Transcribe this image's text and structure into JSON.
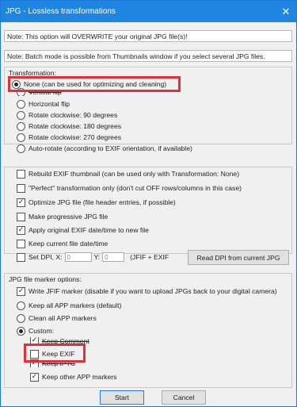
{
  "window": {
    "title": "JPG - Lossless transformations",
    "close_glyph": "✕"
  },
  "notes": {
    "overwrite": "Note: This option will OVERWRITE your original JPG file(s)!",
    "batch": "Note: Batch mode is possible from Thumbnails window if you select several JPG files."
  },
  "transformation": {
    "label": "Transformation:",
    "options": [
      {
        "label": "None (can be used for optimizing and cleaning)",
        "selected": true
      },
      {
        "label": "Vertical flip",
        "selected": false
      },
      {
        "label": "Horizontal flip",
        "selected": false
      },
      {
        "label": "Rotate clockwise: 90 degrees",
        "selected": false
      },
      {
        "label": "Rotate clockwise: 180 degrees",
        "selected": false
      },
      {
        "label": "Rotate clockwise: 270 degrees",
        "selected": false
      },
      {
        "label": "Auto-rotate (according to EXIF orientation, if available)",
        "selected": false
      }
    ]
  },
  "options": {
    "items": [
      {
        "label": "Rebuild EXIF thumbnail (can be used only with Transformation: None)",
        "checked": false
      },
      {
        "label": "\"Perfect\" transformation only (don't cut OFF rows/columns in this case)",
        "checked": false
      },
      {
        "label": "Optimize JPG file (file header entries, if possible)",
        "checked": true
      },
      {
        "label": "Make progressive JPG file",
        "checked": false
      },
      {
        "label": "Apply original EXIF date/time to new file",
        "checked": true
      },
      {
        "label": "Keep current file date/time",
        "checked": false
      }
    ],
    "set_dpi": {
      "label": "Set DPI,  X:",
      "x_value": "0",
      "y_label": "Y:",
      "y_value": "0",
      "suffix": "(JFIF + EXIF",
      "checked": false
    },
    "read_dpi_button": "Read DPI from current JPG"
  },
  "markers": {
    "label": "JPG file marker options:",
    "write_jfif": {
      "label": "Write JFIF marker (disable if you want to upload JPGs back to your digital camera)",
      "checked": true
    },
    "radios": [
      {
        "label": "Keep all APP markers (default)",
        "selected": false
      },
      {
        "label": "Clean all APP markers",
        "selected": false
      },
      {
        "label": "Custom:",
        "selected": true
      }
    ],
    "custom": [
      {
        "label": "Keep Comment",
        "checked": true
      },
      {
        "label": "Keep EXIF",
        "checked": false
      },
      {
        "label": "Keep IPTC",
        "checked": true
      },
      {
        "label": "Keep other APP markers",
        "checked": true
      }
    ]
  },
  "buttons": {
    "start": "Start",
    "cancel": "Cancel"
  },
  "colors": {
    "title_bar": "#1e86e0",
    "highlight": "#e0303a"
  }
}
